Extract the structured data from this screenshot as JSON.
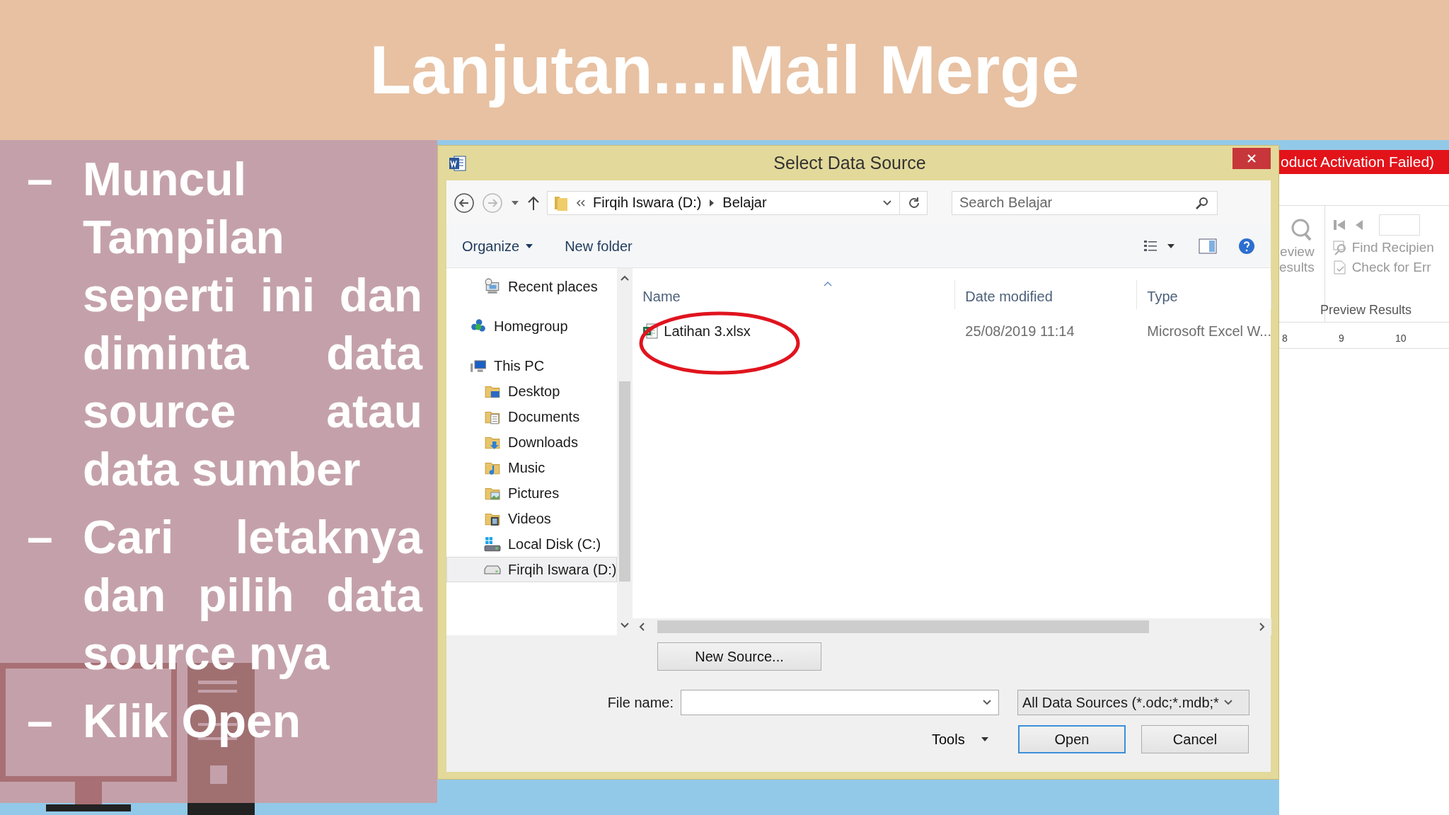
{
  "slide": {
    "title": "Lanjutan....Mail Merge",
    "bullets": [
      {
        "marker": "–",
        "text": "Muncul Tampilan seperti ini dan diminta data source atau data sumber"
      },
      {
        "marker": "–",
        "text": "Cari letaknya dan pilih data source nya"
      },
      {
        "marker": "–",
        "text": "Klik Open"
      }
    ]
  },
  "dialog": {
    "title": "Select Data Source",
    "forward": {
      "disabled": true
    },
    "address": {
      "path": [
        "Firqih Iswara (D:)",
        "Belajar"
      ]
    },
    "search": {
      "placeholder": "Search Belajar"
    },
    "toolbar": {
      "organize": "Organize",
      "new_folder": "New folder"
    },
    "nav_pane": [
      {
        "label": "Recent places",
        "kind": "recent",
        "selected": false
      },
      {
        "label": "Homegroup",
        "kind": "homegroup",
        "selected": false
      },
      {
        "label": "This PC",
        "kind": "pc",
        "selected": false,
        "children": [
          {
            "label": "Desktop",
            "kind": "desktop",
            "selected": false
          },
          {
            "label": "Documents",
            "kind": "documents",
            "selected": false
          },
          {
            "label": "Downloads",
            "kind": "downloads",
            "selected": false
          },
          {
            "label": "Music",
            "kind": "music",
            "selected": false
          },
          {
            "label": "Pictures",
            "kind": "pictures",
            "selected": false
          },
          {
            "label": "Videos",
            "kind": "videos",
            "selected": false
          },
          {
            "label": "Local Disk (C:)",
            "kind": "system-disk",
            "selected": false
          },
          {
            "label": "Firqih Iswara (D:)",
            "kind": "disk",
            "selected": true
          }
        ]
      }
    ],
    "columns": [
      "Name",
      "Date modified",
      "Type"
    ],
    "files": [
      {
        "name": "Latihan 3.xlsx",
        "date": "25/08/2019 11:14",
        "type": "Microsoft Excel W...",
        "circled": true
      }
    ],
    "new_source": "New Source...",
    "file_name_label": "File name:",
    "filter": {
      "value": "All Data Sources (*.odc;*.mdb;*"
    },
    "tools": "Tools",
    "buttons": [
      {
        "label": "Open",
        "default": true
      },
      {
        "label": "Cancel",
        "default": false
      }
    ]
  },
  "word_window": {
    "activation_banner": "oduct Activation Failed)",
    "preview_lines": [
      "eview",
      "esults"
    ],
    "commands": [
      "Find Recipien",
      "Check for Err"
    ],
    "group_label": "Preview Results",
    "ruler": [
      "8",
      "9",
      "10"
    ]
  }
}
